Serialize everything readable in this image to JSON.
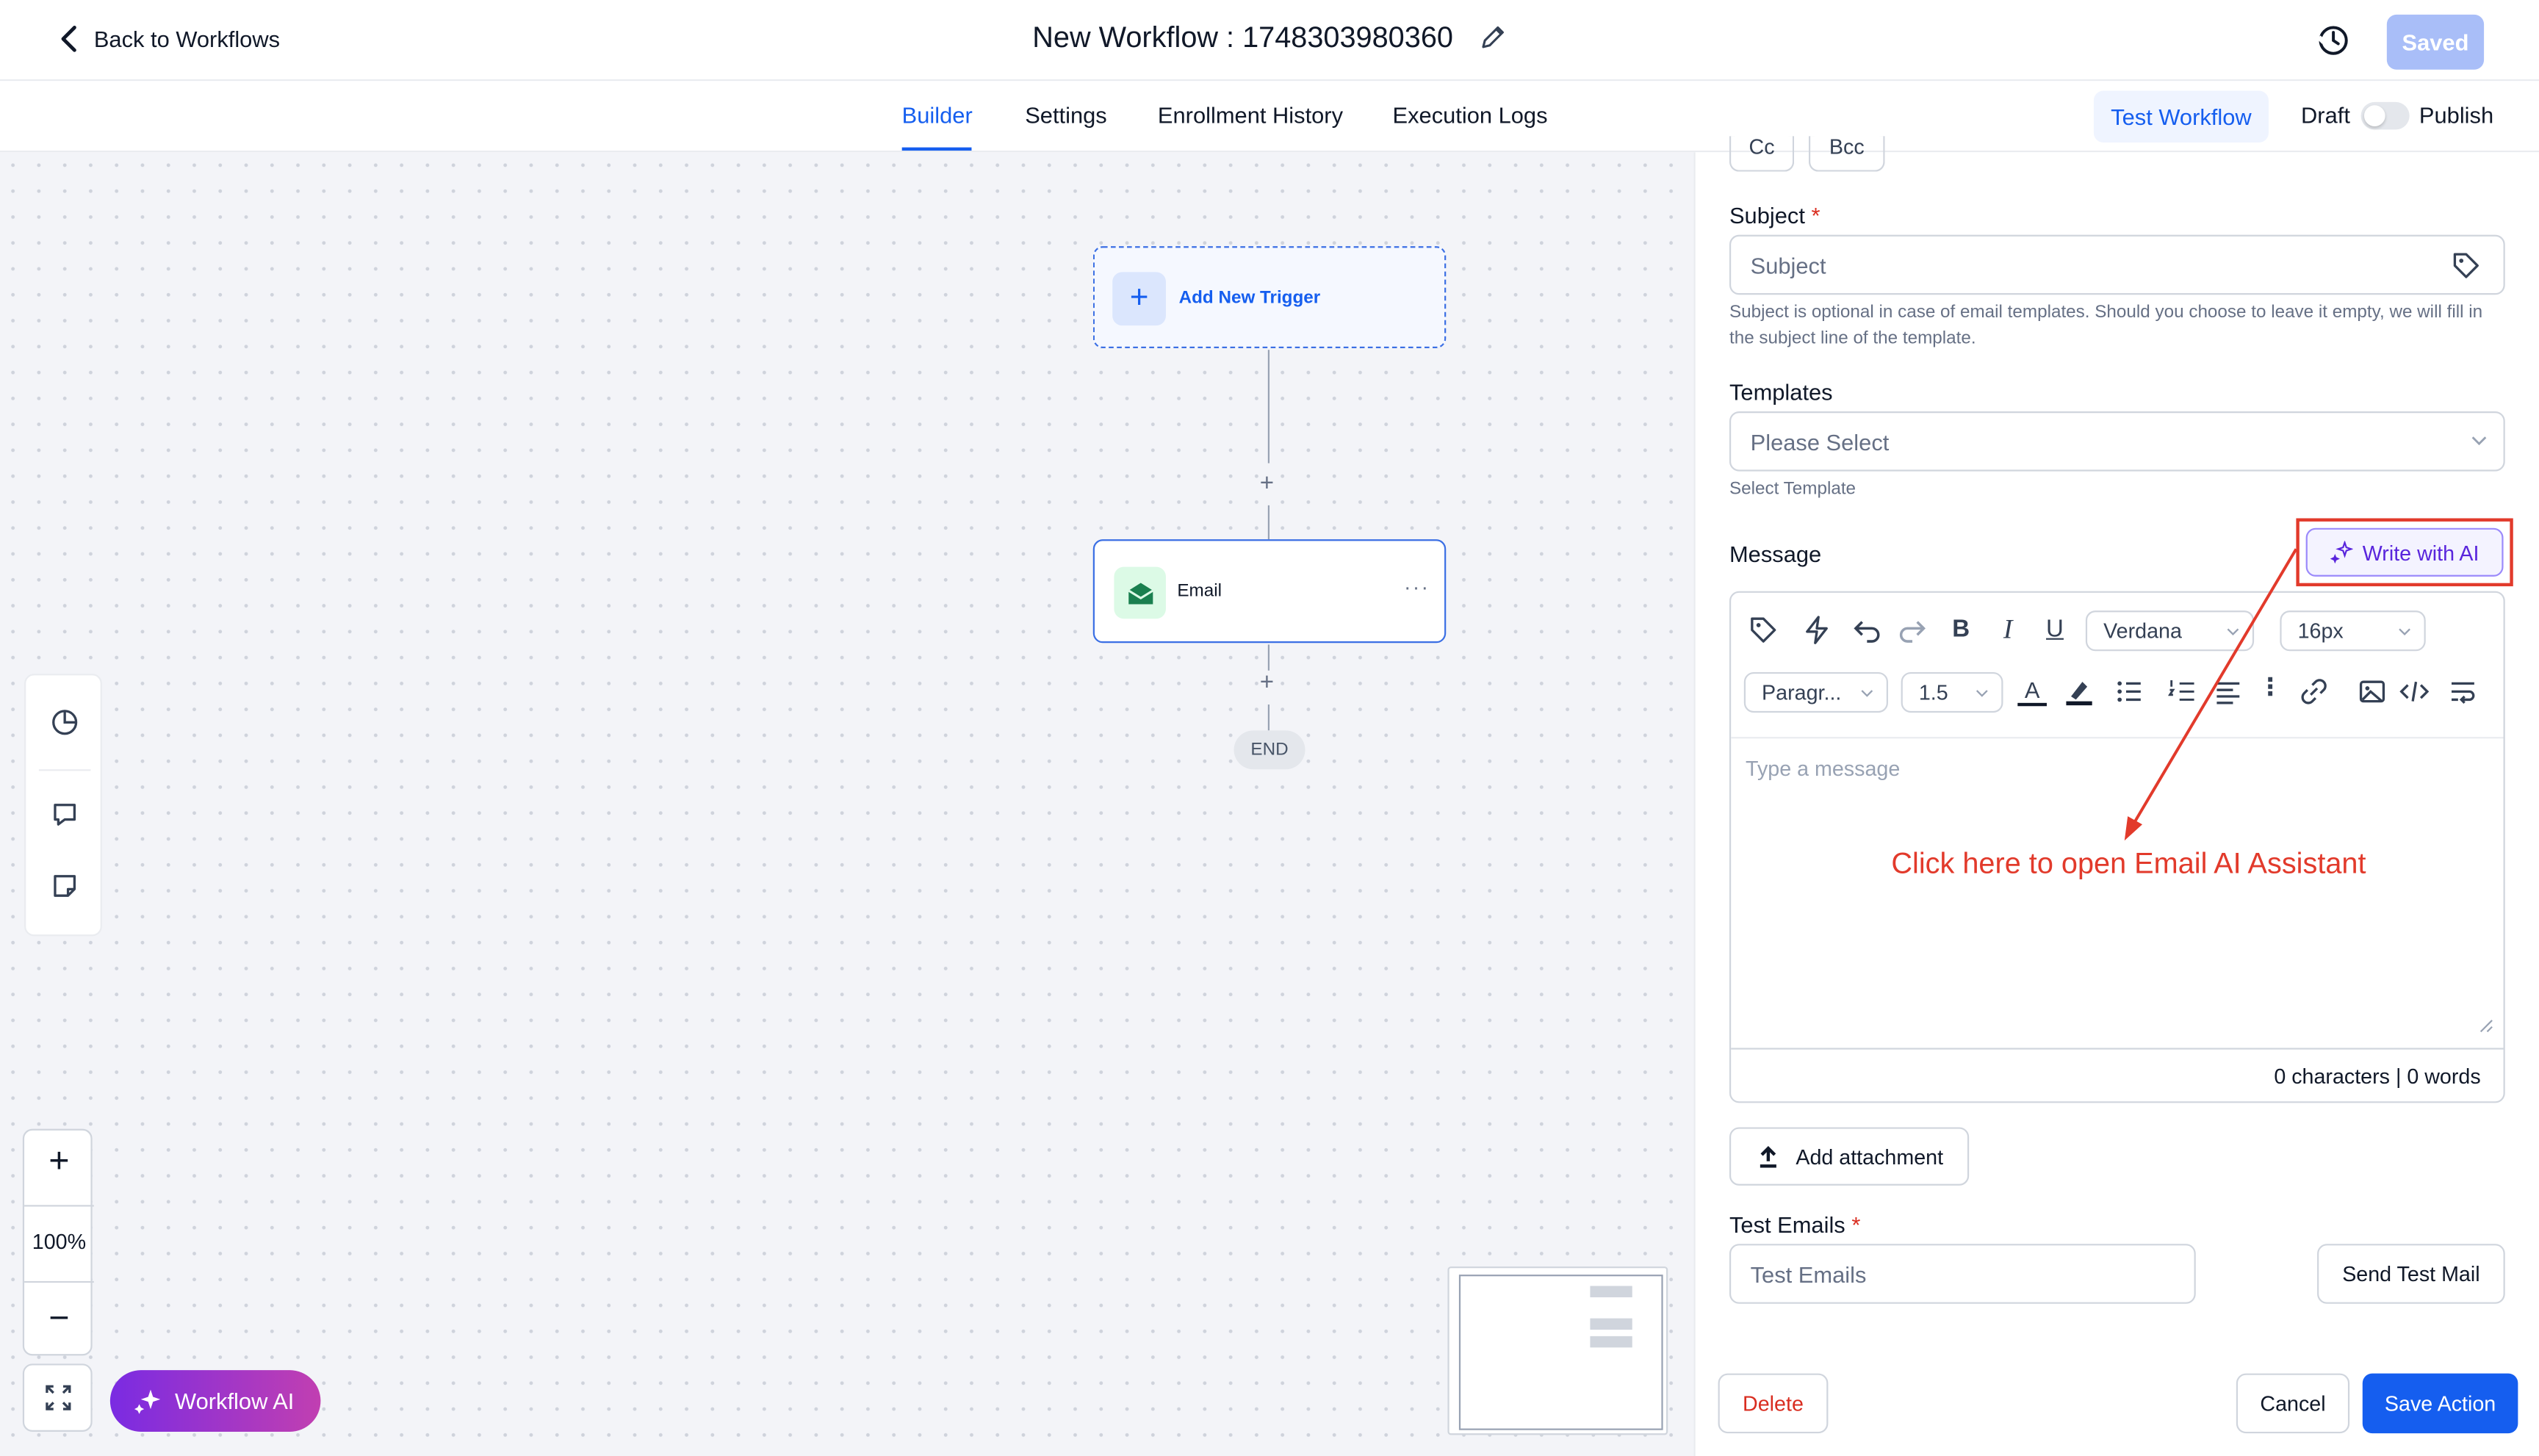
{
  "header": {
    "back_label": "Back to Workflows",
    "title": "New Workflow : 1748303980360",
    "saved_label": "Saved"
  },
  "tabs": [
    {
      "label": "Builder",
      "active": true
    },
    {
      "label": "Settings"
    },
    {
      "label": "Enrollment History"
    },
    {
      "label": "Execution Logs"
    }
  ],
  "toolbar": {
    "test_workflow_label": "Test Workflow",
    "draft_label": "Draft",
    "publish_label": "Publish",
    "publish_enabled": false
  },
  "canvas": {
    "trigger_label": "Add New Trigger",
    "email_node_label": "Email",
    "end_label": "END",
    "zoom_level": "100%",
    "workflow_ai_label": "Workflow AI"
  },
  "panel": {
    "cc_label": "Cc",
    "bcc_label": "Bcc",
    "subject_label": "Subject",
    "required_mark": "*",
    "subject_placeholder": "Subject",
    "subject_hint": "Subject is optional in case of email templates. Should you choose to leave it empty, we will fill in the subject line of the template.",
    "templates_label": "Templates",
    "templates_value": "Please Select",
    "templates_hint": "Select Template",
    "message_label": "Message",
    "write_ai_label": "Write with AI",
    "editor": {
      "font": "Verdana",
      "font_size": "16px",
      "paragraph": "Paragr...",
      "line_height": "1.5",
      "placeholder": "Type a message",
      "count": "0 characters | 0 words"
    },
    "annotation": "Click here to open Email AI Assistant",
    "attachment_label": "Add attachment",
    "test_emails_label": "Test Emails",
    "test_emails_placeholder": "Test Emails",
    "send_test_label": "Send Test Mail",
    "delete_label": "Delete",
    "cancel_label": "Cancel",
    "save_label": "Save Action"
  },
  "colors": {
    "primary": "#155eef",
    "saved_disabled": "#a9bef8",
    "annotation_red": "#e23a2b",
    "ai_purple": "#5925dc",
    "delete_red": "#d92d20"
  }
}
